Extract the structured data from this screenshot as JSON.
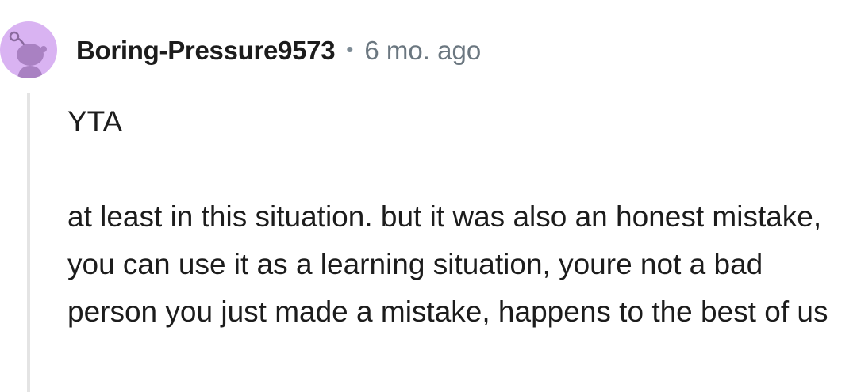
{
  "comment": {
    "author": "Boring-Pressure9573",
    "separator": "•",
    "timestamp": "6 mo. ago",
    "avatar_icon": "snoo-avatar-icon",
    "avatar_bg": "#d9b3f2",
    "paragraphs": [
      "YTA",
      "at least in this situation. but it was also an honest mistake, you can use it as a learning situation, youre not a bad person you just made a mistake, happens to the best of us"
    ]
  }
}
